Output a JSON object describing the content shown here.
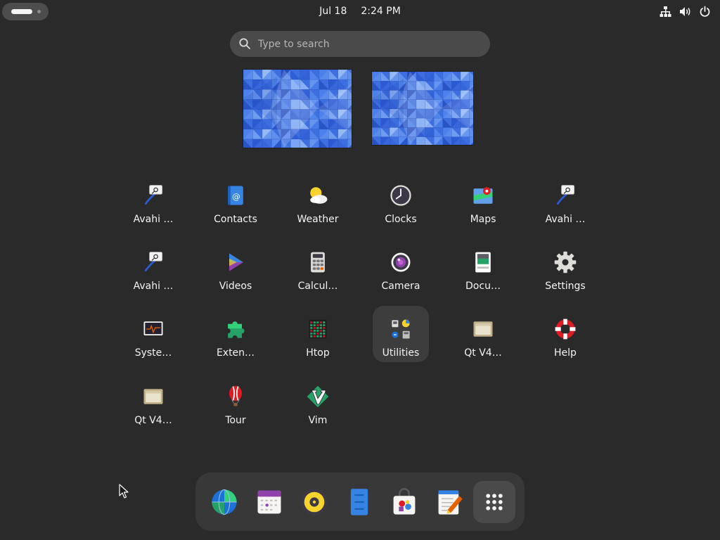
{
  "topbar": {
    "date": "Jul 18",
    "time": "2:24 PM",
    "status_icons": [
      "network-wired-icon",
      "volume-icon",
      "power-icon"
    ]
  },
  "search": {
    "placeholder": "Type to search"
  },
  "workspaces": [
    {
      "name": "workspace-1"
    },
    {
      "name": "workspace-2"
    }
  ],
  "apps": [
    {
      "label": "Avahi …",
      "icon": "avahi-icon"
    },
    {
      "label": "Contacts",
      "icon": "contacts-icon"
    },
    {
      "label": "Weather",
      "icon": "weather-icon"
    },
    {
      "label": "Clocks",
      "icon": "clocks-icon"
    },
    {
      "label": "Maps",
      "icon": "maps-icon"
    },
    {
      "label": "Avahi …",
      "icon": "avahi-icon"
    },
    {
      "label": "Avahi …",
      "icon": "avahi-icon"
    },
    {
      "label": "Videos",
      "icon": "videos-icon"
    },
    {
      "label": "Calcul…",
      "icon": "calculator-icon"
    },
    {
      "label": "Camera",
      "icon": "camera-icon"
    },
    {
      "label": "Docu…",
      "icon": "document-viewer-icon"
    },
    {
      "label": "Settings",
      "icon": "settings-icon"
    },
    {
      "label": "Syste…",
      "icon": "system-monitor-icon"
    },
    {
      "label": "Exten…",
      "icon": "extensions-icon"
    },
    {
      "label": "Htop",
      "icon": "htop-icon"
    },
    {
      "label": "Utilities",
      "icon": "utilities-icon",
      "highlighted": true
    },
    {
      "label": "Qt V4…",
      "icon": "qt-v4l2-icon"
    },
    {
      "label": "Help",
      "icon": "help-icon"
    },
    {
      "label": "Qt V4…",
      "icon": "qt-v4l2-icon"
    },
    {
      "label": "Tour",
      "icon": "tour-icon"
    },
    {
      "label": "Vim",
      "icon": "vim-icon"
    }
  ],
  "dash": [
    {
      "name": "web-browser",
      "icon": "web-browser-icon"
    },
    {
      "name": "calendar",
      "icon": "calendar-icon"
    },
    {
      "name": "music",
      "icon": "music-icon"
    },
    {
      "name": "files",
      "icon": "files-icon"
    },
    {
      "name": "software",
      "icon": "software-icon"
    },
    {
      "name": "text-editor",
      "icon": "text-editor-icon"
    },
    {
      "name": "show-apps",
      "icon": "app-grid-icon",
      "highlighted": true
    }
  ],
  "colors": {
    "background": "#2a2a2a",
    "wallpaper_blue": "#3d6fe0",
    "highlight": "#3d3d3d"
  }
}
